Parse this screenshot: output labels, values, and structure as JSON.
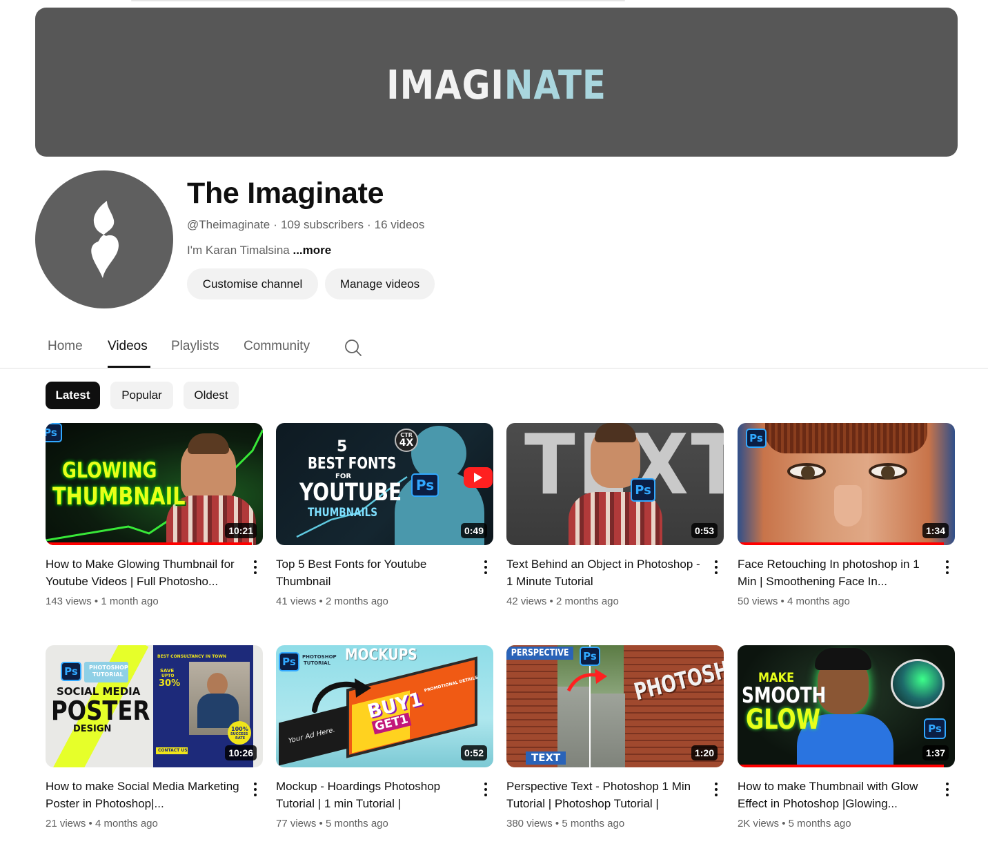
{
  "banner": {
    "logo_part1": "IMAGI",
    "logo_part2": "NATE"
  },
  "channel": {
    "name": "The Imaginate",
    "handle": "@Theimaginate",
    "subscribers": "109 subscribers",
    "videos": "16 videos",
    "separator": "·",
    "description": "I'm Karan Timalsina",
    "more": "...more"
  },
  "buttons": {
    "customise": "Customise channel",
    "manage": "Manage videos"
  },
  "tabs": [
    "Home",
    "Videos",
    "Playlists",
    "Community"
  ],
  "active_tab": "Videos",
  "chips": [
    "Latest",
    "Popular",
    "Oldest"
  ],
  "active_chip": "Latest",
  "meta_separator": "•",
  "videos": [
    {
      "title": "How to Make Glowing Thumbnail for Youtube Videos | Full Photosho...",
      "views": "143 views",
      "age": "1 month ago",
      "duration": "10:21",
      "watched_fraction": 0.95,
      "thumb": {
        "line1": "GLOWING",
        "line2": "THUMBNAIL",
        "badge": "Ps"
      }
    },
    {
      "title": "Top 5 Best Fonts for Youtube Thumbnail",
      "views": "41 views",
      "age": "2 months ago",
      "duration": "0:49",
      "watched_fraction": 0,
      "thumb": {
        "num": "5",
        "line1": "BEST FONTS",
        "line2": "FOR",
        "line3": "YOUTUBE",
        "line4": "THUMBNAILS",
        "ctr": "CTR",
        "ctr_val": "4X",
        "badge": "Ps"
      }
    },
    {
      "title": "Text Behind an Object in Photoshop - 1 Minute Tutorial",
      "views": "42 views",
      "age": "2 months ago",
      "duration": "0:53",
      "watched_fraction": 0,
      "thumb": {
        "big": "TEXT",
        "badge": "Ps"
      }
    },
    {
      "title": "Face Retouching In photoshop in 1 Min | Smoothening Face In...",
      "views": "50 views",
      "age": "4 months ago",
      "duration": "1:34",
      "watched_fraction": 0.95,
      "thumb": {
        "badge": "Ps"
      }
    },
    {
      "title": "How to make Social Media Marketing Poster in Photoshop|...",
      "views": "21 views",
      "age": "4 months ago",
      "duration": "10:26",
      "watched_fraction": 0,
      "thumb": {
        "badge": "Ps",
        "tag1": "PHOTOSHOP",
        "tag2": "TUTORIAL",
        "line1": "SOCIAL MEDIA",
        "line2": "POSTER",
        "line3": "DESIGN",
        "poster_head": "BEST CONSULTANCY IN TOWN",
        "save": "SAVE",
        "upto": "UPTO",
        "pct": "30%",
        "rate1": "100%",
        "rate2": "SUCCESS",
        "rate3": "RATE",
        "contact": "CONTACT US"
      }
    },
    {
      "title": "Mockup - Hoardings Photoshop Tutorial | 1 min Tutorial |",
      "views": "77 views",
      "age": "5 months ago",
      "duration": "0:52",
      "watched_fraction": 0,
      "thumb": {
        "badge": "Ps",
        "tag1": "PHOTOSHOP",
        "tag2": "TUTORIAL",
        "line1": "MOCKUPS",
        "ad": "Your Ad Here.",
        "buy": "BUY1",
        "get": "GET1",
        "promo": "PROMOTIONAL DETAILS"
      }
    },
    {
      "title": "Perspective Text - Photoshop 1 Min Tutorial | Photoshop Tutorial |",
      "views": "380 views",
      "age": "5 months ago",
      "duration": "1:20",
      "watched_fraction": 0,
      "thumb": {
        "badge": "Ps",
        "line1": "PERSPECTIVE",
        "line2": "TEXT",
        "wall": "PHOTOSHOP"
      }
    },
    {
      "title": "How to make Thumbnail with Glow Effect in Photoshop |Glowing...",
      "views": "2K views",
      "age": "5 months ago",
      "duration": "1:37",
      "watched_fraction": 0.95,
      "thumb": {
        "badge": "Ps",
        "line1": "MAKE",
        "line2": "SMOOTH",
        "line3": "GLOW"
      }
    }
  ],
  "colors": {
    "accent": "#ff0000",
    "text": "#0f0f0f",
    "secondary": "#606060",
    "chip_bg": "#f2f2f2",
    "banner_bg": "#575757",
    "ps_blue": "#31a8ff"
  },
  "icons": {
    "search": "search-icon",
    "more": "more-vert-icon",
    "avatar_logo": "imaginate-logo-icon"
  }
}
